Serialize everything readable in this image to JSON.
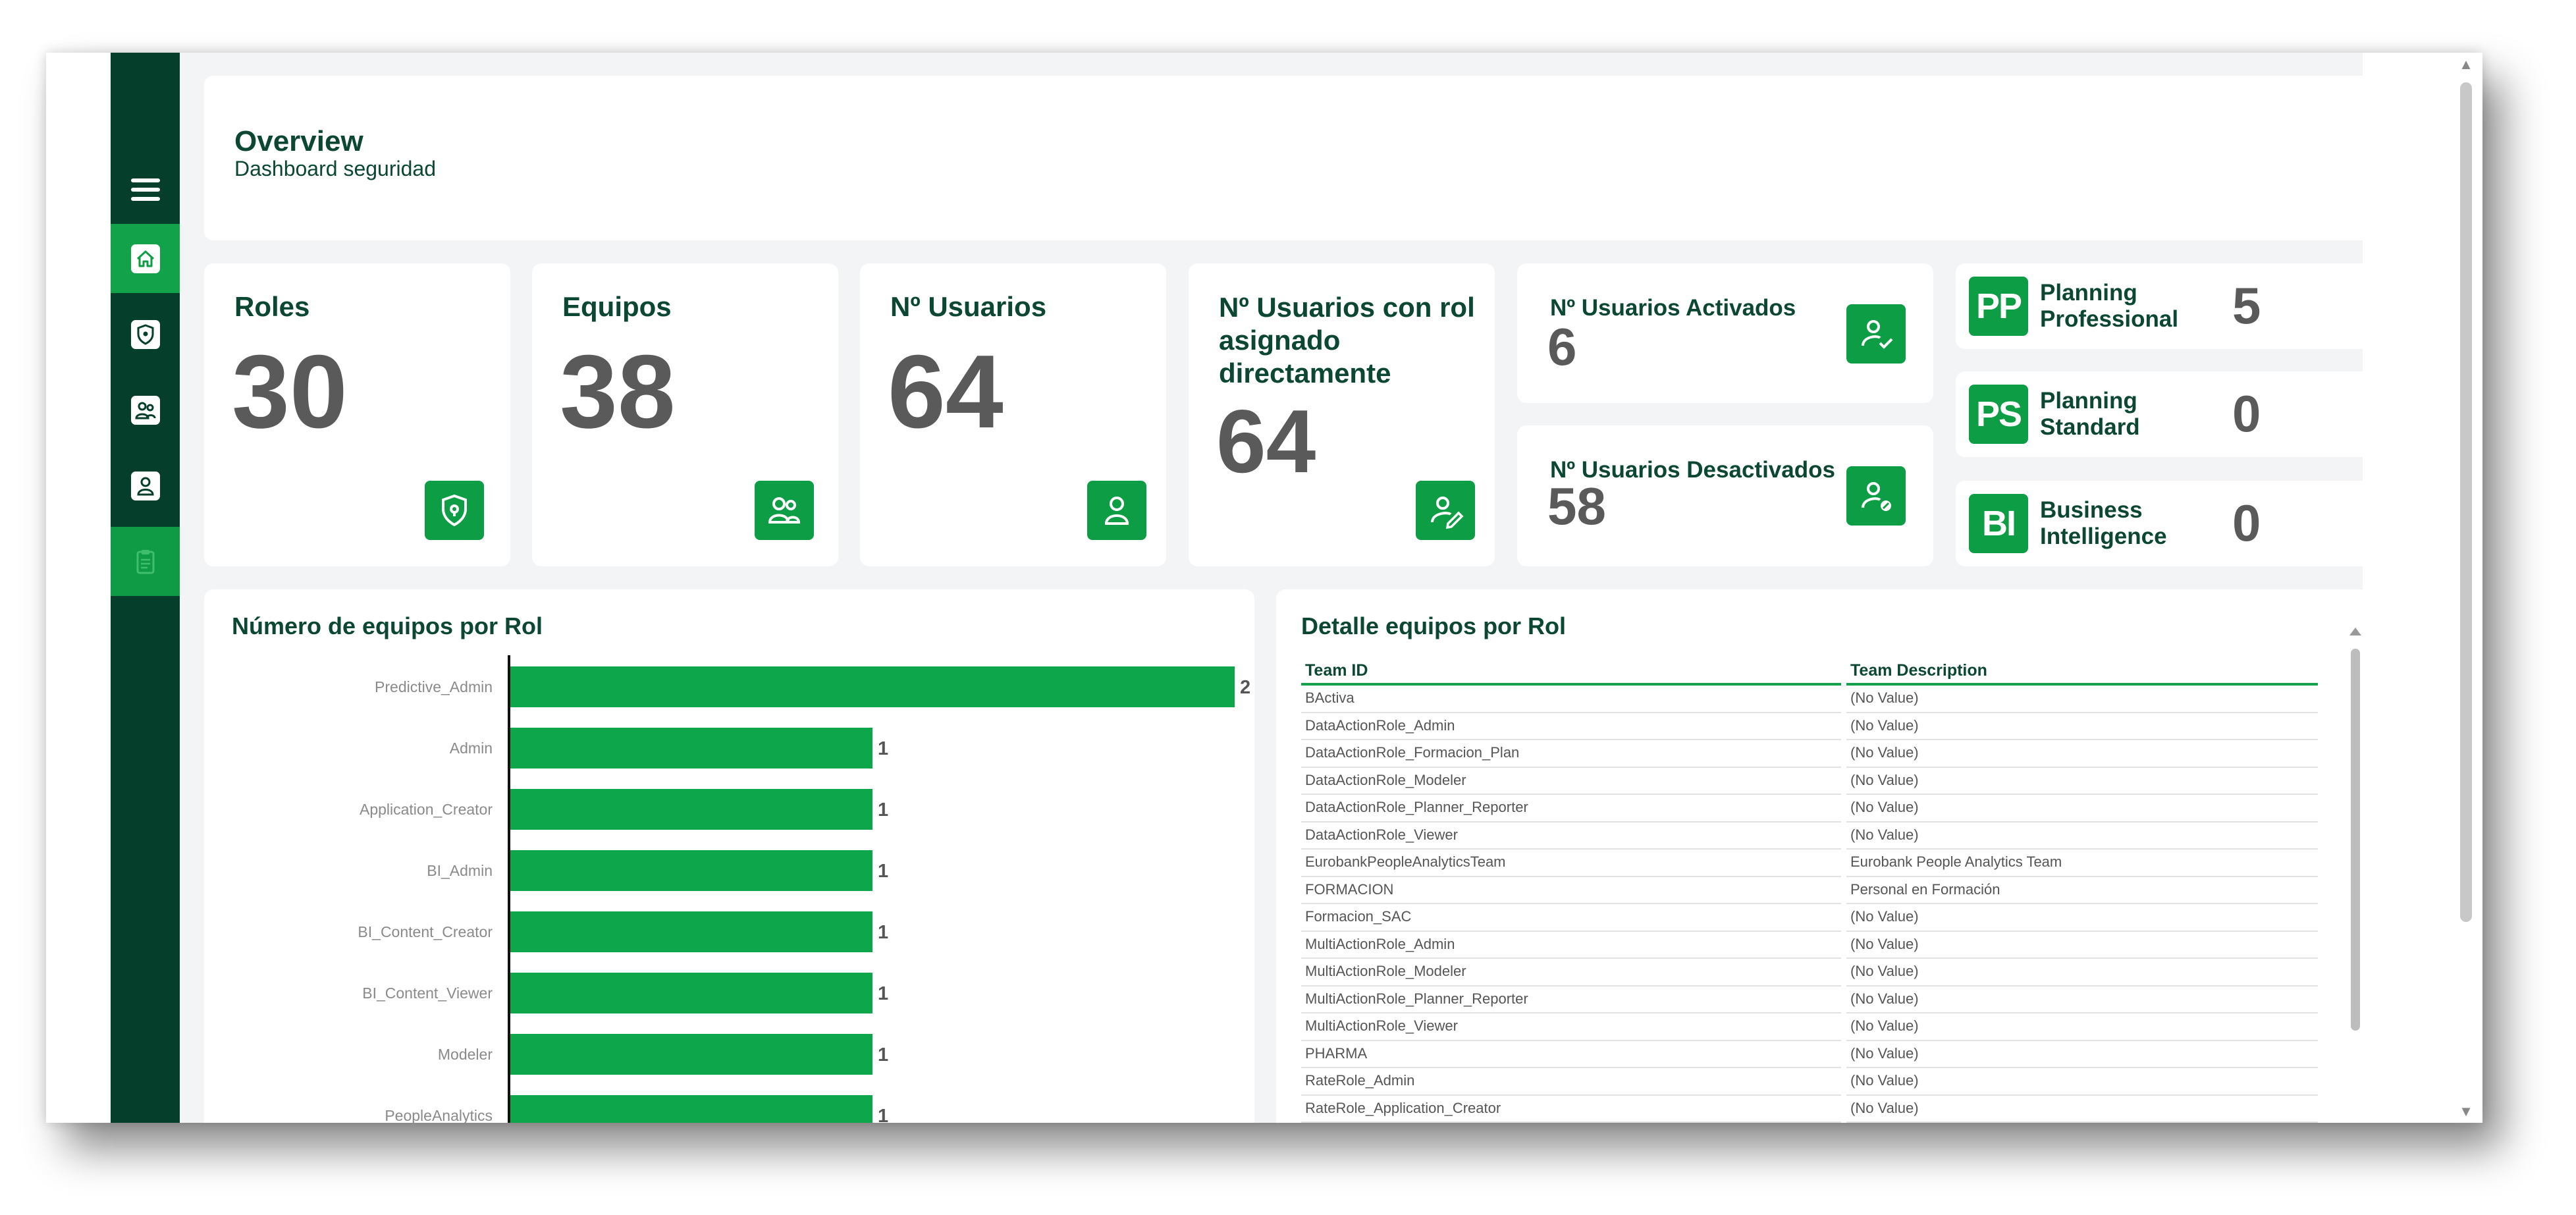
{
  "header": {
    "title": "Overview",
    "subtitle": "Dashboard seguridad"
  },
  "sidebar": {
    "items": [
      {
        "icon": "menu-icon"
      },
      {
        "icon": "home-icon"
      },
      {
        "icon": "shield-icon"
      },
      {
        "icon": "team-icon"
      },
      {
        "icon": "user-icon"
      },
      {
        "icon": "clipboard-icon"
      }
    ]
  },
  "kpis": {
    "roles": {
      "label": "Roles",
      "value": "30",
      "icon": "shield-icon"
    },
    "equipos": {
      "label": "Equipos",
      "value": "38",
      "icon": "team-icon"
    },
    "usuarios": {
      "label": "Nº Usuarios",
      "value": "64",
      "icon": "user-icon"
    },
    "usuarios_rol": {
      "label": "Nº Usuarios con rol asignado directamente",
      "value": "64",
      "icon": "user-edit-icon"
    },
    "activados": {
      "label": "Nº Usuarios Activados",
      "value": "6",
      "icon": "user-check-icon"
    },
    "desactivados": {
      "label": "Nº Usuarios Desactivados",
      "value": "58",
      "icon": "user-disabled-icon"
    }
  },
  "licenses": [
    {
      "abbr": "PP",
      "line1": "Planning",
      "line2": "Professional",
      "value": "5"
    },
    {
      "abbr": "PS",
      "line1": "Planning",
      "line2": "Standard",
      "value": "0"
    },
    {
      "abbr": "BI",
      "line1": "Business",
      "line2": "Intelligence",
      "value": "0"
    }
  ],
  "chart_panel": {
    "title": "Número de equipos por Rol"
  },
  "chart_data": {
    "type": "bar",
    "orientation": "horizontal",
    "title": "Número de equipos por Rol",
    "categories": [
      "Predictive_Admin",
      "Admin",
      "Application_Creator",
      "BI_Admin",
      "BI_Content_Creator",
      "BI_Content_Viewer",
      "Modeler",
      "PeopleAnalytics"
    ],
    "values": [
      2,
      1,
      1,
      1,
      1,
      1,
      1,
      1
    ],
    "data_labels": true,
    "colors": {
      "bar": "#0ea64a"
    }
  },
  "table_panel": {
    "title": "Detalle equipos por Rol",
    "columns": [
      "Team ID",
      "Team Description"
    ],
    "rows": [
      [
        "BActiva",
        "(No Value)"
      ],
      [
        "DataActionRole_Admin",
        "(No Value)"
      ],
      [
        "DataActionRole_Formacion_Plan",
        "(No Value)"
      ],
      [
        "DataActionRole_Modeler",
        "(No Value)"
      ],
      [
        "DataActionRole_Planner_Reporter",
        "(No Value)"
      ],
      [
        "DataActionRole_Viewer",
        "(No Value)"
      ],
      [
        "EurobankPeopleAnalyticsTeam",
        "Eurobank People Analytics Team"
      ],
      [
        "FORMACION",
        "Personal en Formación"
      ],
      [
        "Formacion_SAC",
        "(No Value)"
      ],
      [
        "MultiActionRole_Admin",
        "(No Value)"
      ],
      [
        "MultiActionRole_Modeler",
        "(No Value)"
      ],
      [
        "MultiActionRole_Planner_Reporter",
        "(No Value)"
      ],
      [
        "MultiActionRole_Viewer",
        "(No Value)"
      ],
      [
        "PHARMA",
        "(No Value)"
      ],
      [
        "RateRole_Admin",
        "(No Value)"
      ],
      [
        "RateRole_Application_Creator",
        "(No Value)"
      ]
    ]
  },
  "colors": {
    "brand_dark": "#053f2b",
    "accent": "#0d9d45",
    "title": "#0b4732"
  }
}
